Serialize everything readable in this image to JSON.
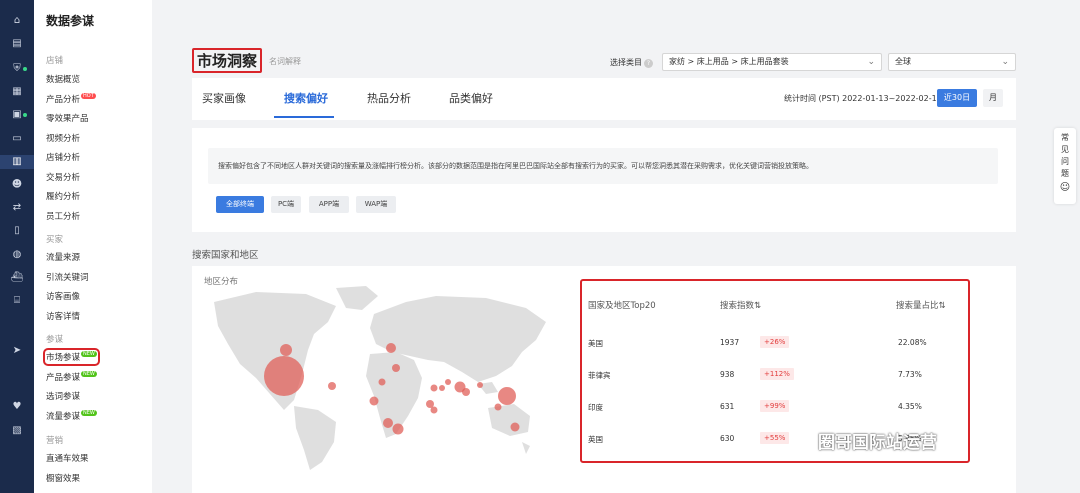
{
  "sidebar": {
    "title": "数据参谋",
    "sections": [
      {
        "heading": "店铺",
        "items": [
          {
            "label": "数据概览"
          },
          {
            "label": "产品分析",
            "tag": "HOT"
          },
          {
            "label": "零效果产品"
          },
          {
            "label": "视频分析"
          },
          {
            "label": "店铺分析"
          },
          {
            "label": "交易分析"
          },
          {
            "label": "履约分析"
          },
          {
            "label": "员工分析"
          }
        ]
      },
      {
        "heading": "买家",
        "items": [
          {
            "label": "流量来源"
          },
          {
            "label": "引流关键词"
          },
          {
            "label": "访客画像"
          },
          {
            "label": "访客详情"
          }
        ]
      },
      {
        "heading": "参谋",
        "items": [
          {
            "label": "市场参谋",
            "tag": "NEW"
          },
          {
            "label": "产品参谋",
            "tag": "NEW"
          },
          {
            "label": "选词参谋"
          },
          {
            "label": "流量参谋",
            "tag": "NEW"
          }
        ]
      },
      {
        "heading": "营销",
        "items": [
          {
            "label": "直通车效果"
          },
          {
            "label": "橱窗效果"
          }
        ]
      }
    ]
  },
  "rail_icons": [
    "home-icon",
    "store-icon",
    "shield-icon",
    "apps-icon",
    "calendar-icon",
    "message-icon",
    "chart-icon",
    "users-icon",
    "share-icon",
    "document-icon",
    "globe-icon",
    "ship-icon",
    "bank-icon",
    "send-icon",
    "heart-icon",
    "briefcase-icon"
  ],
  "header": {
    "title": "市场洞察",
    "note": "名词解释",
    "category_label": "选择类目",
    "category_help": "?",
    "category_value": "家纺 > 床上用品 > 床上用品套装",
    "region_value": "全球"
  },
  "tabs": {
    "items": [
      "买家画像",
      "搜索偏好",
      "热品分析",
      "品类偏好"
    ],
    "active_index": 1,
    "stat_text": "统计时间 (PST) 2022-01-13~2022-02-12",
    "btn_30": "近30日",
    "btn_month": "月"
  },
  "description": {
    "text": "搜索偏好包含了不同地区人群对关键词的搜索量及涨幅排行榜分析。该部分的数据范围是指在阿里巴巴国际站全部有搜索行为的买家。可以帮您洞悉其潜在采购需求，优化关键词营销投放策略。",
    "filters": [
      "全部终端",
      "PC端",
      "APP端",
      "WAP端"
    ],
    "active_filter": 0
  },
  "section_title": "搜索国家和地区",
  "map": {
    "title": "地区分布"
  },
  "table": {
    "headers": [
      "国家及地区Top20",
      "搜索指数⇅",
      "搜索量占比⇅"
    ],
    "rows": [
      {
        "country": "美国",
        "index": "1937",
        "change": "+26%",
        "share": "22.08%"
      },
      {
        "country": "菲律宾",
        "index": "938",
        "change": "+112%",
        "share": "7.73%"
      },
      {
        "country": "印度",
        "index": "631",
        "change": "+99%",
        "share": "4.35%"
      },
      {
        "country": "英国",
        "index": "630",
        "change": "+55%",
        "share": "5.85%"
      }
    ]
  },
  "faq_label": "常见问题",
  "watermark": "圈哥国际站运营",
  "colors": {
    "accent": "#3a7be0",
    "highlight": "#d9252a",
    "bubble": "#e0605a"
  }
}
